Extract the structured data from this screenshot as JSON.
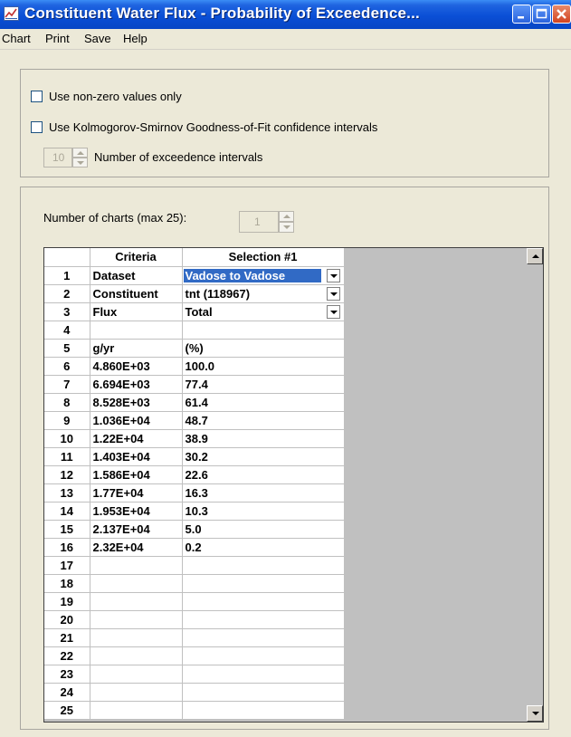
{
  "window": {
    "title": "Constituent Water Flux - Probability of Exceedence..."
  },
  "menu": [
    "Chart",
    "Print",
    "Save",
    "Help"
  ],
  "options": {
    "nonzero_label": "Use non-zero values only",
    "nonzero_checked": false,
    "ks_label": "Use Kolmogorov-Smirnov Goodness-of-Fit confidence intervals",
    "ks_checked": false,
    "intervals_value": "10",
    "intervals_label": "Number of exceedence intervals"
  },
  "charts": {
    "count_label": "Number of charts (max 25):",
    "count_value": "1"
  },
  "grid": {
    "headers": [
      "Criteria",
      "Selection #1"
    ],
    "rows": [
      {
        "n": "1",
        "c": "Dataset",
        "s": "Vadose to Vadose",
        "dropdown": true,
        "selected": true
      },
      {
        "n": "2",
        "c": "Constituent",
        "s": "tnt (118967)",
        "dropdown": true
      },
      {
        "n": "3",
        "c": "Flux",
        "s": "Total",
        "dropdown": true
      },
      {
        "n": "4",
        "c": "",
        "s": ""
      },
      {
        "n": "5",
        "c": "g/yr",
        "s": "(%)"
      },
      {
        "n": "6",
        "c": "4.860E+03",
        "s": "100.0"
      },
      {
        "n": "7",
        "c": "6.694E+03",
        "s": "77.4"
      },
      {
        "n": "8",
        "c": "8.528E+03",
        "s": "61.4"
      },
      {
        "n": "9",
        "c": "1.036E+04",
        "s": "48.7"
      },
      {
        "n": "10",
        "c": "1.22E+04",
        "s": "38.9"
      },
      {
        "n": "11",
        "c": "1.403E+04",
        "s": "30.2"
      },
      {
        "n": "12",
        "c": "1.586E+04",
        "s": "22.6"
      },
      {
        "n": "13",
        "c": "1.77E+04",
        "s": "16.3"
      },
      {
        "n": "14",
        "c": "1.953E+04",
        "s": "10.3"
      },
      {
        "n": "15",
        "c": "2.137E+04",
        "s": "5.0"
      },
      {
        "n": "16",
        "c": "2.32E+04",
        "s": "0.2"
      },
      {
        "n": "17",
        "c": "",
        "s": ""
      },
      {
        "n": "18",
        "c": "",
        "s": ""
      },
      {
        "n": "19",
        "c": "",
        "s": ""
      },
      {
        "n": "20",
        "c": "",
        "s": ""
      },
      {
        "n": "21",
        "c": "",
        "s": ""
      },
      {
        "n": "22",
        "c": "",
        "s": ""
      },
      {
        "n": "23",
        "c": "",
        "s": ""
      },
      {
        "n": "24",
        "c": "",
        "s": ""
      },
      {
        "n": "25",
        "c": "",
        "s": ""
      }
    ]
  },
  "colors": {
    "titlebar": "#0a4fd6",
    "selection": "#316ac5",
    "empty_grid_area": "#c0c0c0"
  }
}
